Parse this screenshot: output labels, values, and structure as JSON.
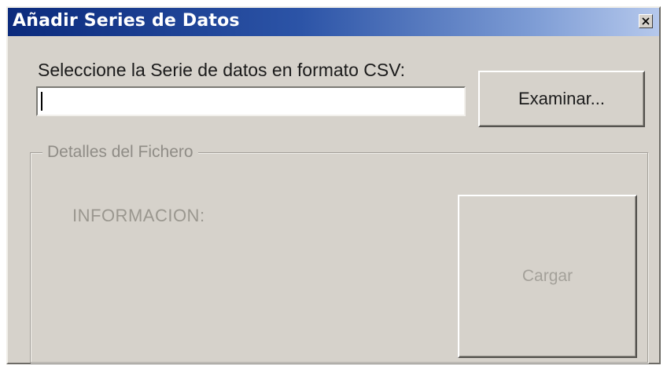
{
  "window": {
    "title": "Añadir Series de Datos"
  },
  "form": {
    "select_label": "Seleccione la Serie de datos en formato CSV:",
    "file_path_value": "",
    "browse_label": "Examinar..."
  },
  "details": {
    "group_title": "Detalles del Fichero",
    "info_label": "INFORMACION:",
    "load_label": "Cargar",
    "load_enabled": false
  },
  "icons": {
    "close": "close-icon"
  },
  "colors": {
    "title_gradient_start": "#0b2a7c",
    "title_gradient_end": "#b5c8ec",
    "face": "#d6d2cb",
    "disabled_text": "#9a978f"
  }
}
